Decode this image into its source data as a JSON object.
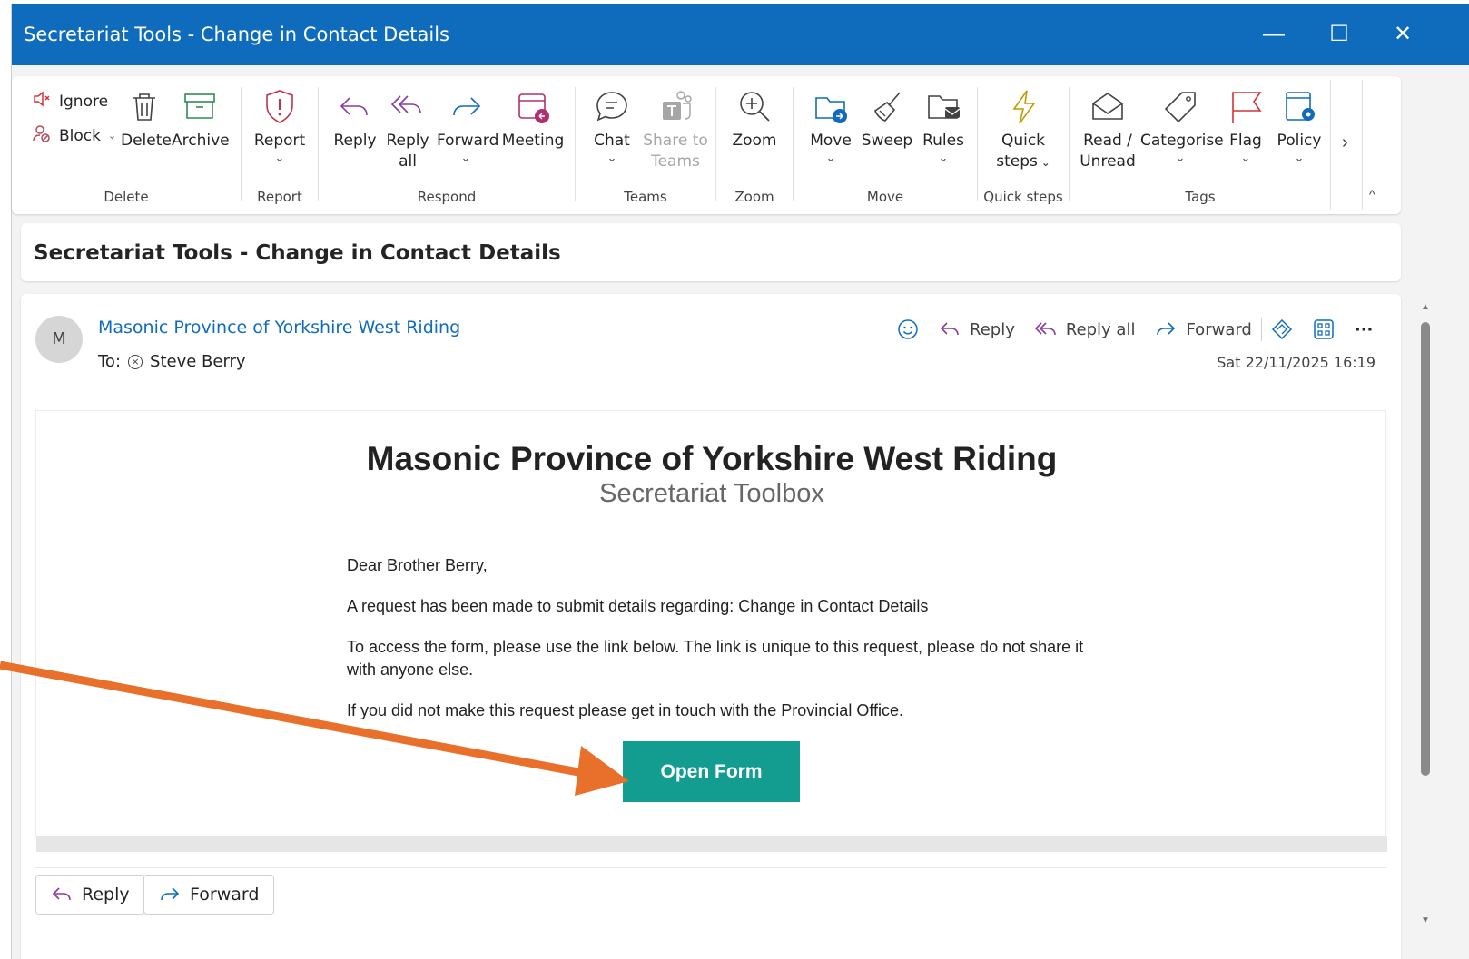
{
  "window": {
    "title": "Secretariat Tools - Change in Contact Details",
    "minimize": "—",
    "maximize": "☐",
    "close": "✕"
  },
  "ribbon": {
    "delete_group": {
      "ignore": "Ignore",
      "block": "Block",
      "delete": "Delete",
      "archive": "Archive",
      "label": "Delete"
    },
    "report_group": {
      "report": "Report",
      "label": "Report"
    },
    "respond_group": {
      "reply": "Reply",
      "reply_all_line1": "Reply",
      "reply_all_line2": "all",
      "forward": "Forward",
      "meeting": "Meeting",
      "label": "Respond"
    },
    "teams_group": {
      "chat": "Chat",
      "share_line1": "Share to",
      "share_line2": "Teams",
      "label": "Teams"
    },
    "zoom_group": {
      "zoom": "Zoom",
      "label": "Zoom"
    },
    "move_group": {
      "move": "Move",
      "sweep": "Sweep",
      "rules": "Rules",
      "label": "Move"
    },
    "quicksteps_group": {
      "quick_line1": "Quick",
      "quick_line2": "steps",
      "label": "Quick steps"
    },
    "tags_group": {
      "read_line1": "Read /",
      "read_line2": "Unread",
      "categorise": "Categorise",
      "flag": "Flag",
      "policy": "Policy",
      "label": "Tags"
    },
    "more": "›",
    "collapse": "^"
  },
  "subject": "Secretariat Tools - Change in Contact Details",
  "message": {
    "avatar_initial": "M",
    "sender": "Masonic Province of Yorkshire West Riding",
    "to_label": "To:",
    "recipient": "Steve Berry",
    "date": "Sat 22/11/2025 16:19",
    "actions": {
      "reply": "Reply",
      "reply_all": "Reply all",
      "forward": "Forward",
      "more": "···"
    }
  },
  "email": {
    "org_name": "Masonic Province of Yorkshire West Riding",
    "subtitle": "Secretariat Toolbox",
    "greeting": "Dear Brother Berry,",
    "line1": "A request has been made to submit details regarding: Change in Contact Details",
    "line2": "To access the form, please use the link below. The link is unique to this request, please do not share it with anyone else.",
    "line3": "If you did not make this request please get in touch with the Provincial Office.",
    "button": "Open Form"
  },
  "footer": {
    "reply": "Reply",
    "forward": "Forward"
  },
  "colors": {
    "titlebar": "#0f6cbd",
    "accent_button": "#139c90",
    "annotation_arrow": "#e8702a",
    "sender_link": "#0f6cbd"
  }
}
